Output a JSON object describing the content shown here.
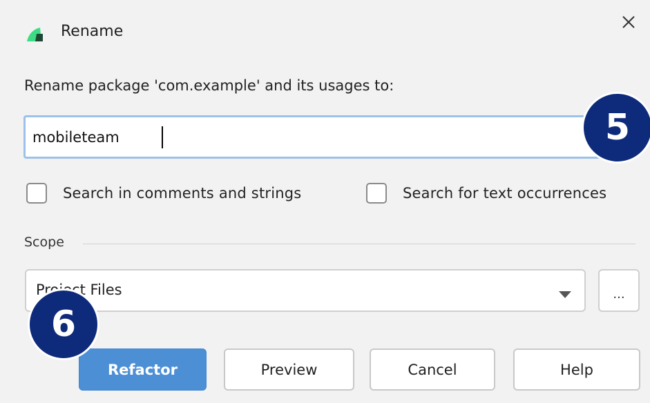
{
  "window": {
    "title": "Rename",
    "app_icon": "android-studio-icon",
    "close_icon": "close-icon"
  },
  "form": {
    "prompt": "Rename package 'com.example' and its usages to:",
    "new_name_value": "mobileteam",
    "checkboxes": [
      {
        "label": "Search in comments and strings",
        "checked": false
      },
      {
        "label": "Search for text occurrences",
        "checked": false
      }
    ],
    "scope": {
      "section_label": "Scope",
      "selected": "Project Files",
      "more_label": "..."
    }
  },
  "buttons": {
    "refactor": "Refactor",
    "preview": "Preview",
    "cancel": "Cancel",
    "help": "Help"
  },
  "annotations": {
    "step_5": "5",
    "step_6": "6"
  },
  "colors": {
    "primary_button": "#4d8fd5",
    "badge": "#0e2b7b",
    "input_focus_border": "#9cc1ea"
  }
}
